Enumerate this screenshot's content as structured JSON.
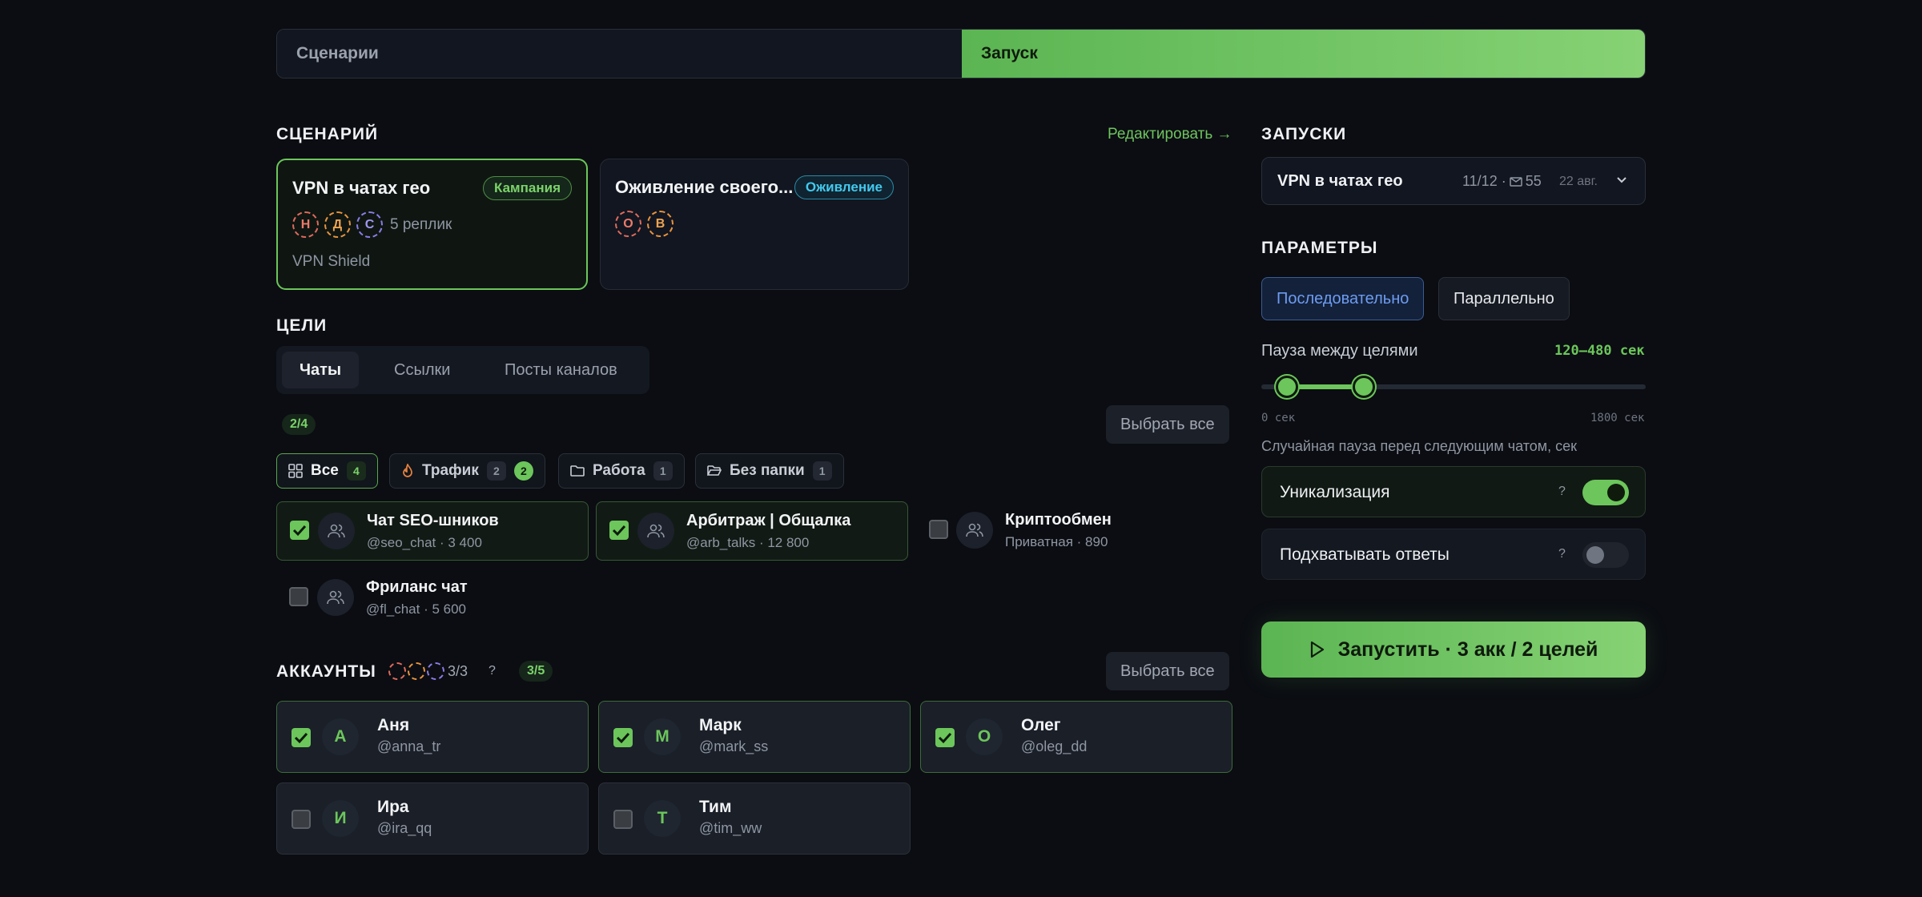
{
  "top_tabs": {
    "scenarios": "Сценарии",
    "launch": "Запуск"
  },
  "scenario_section": {
    "title": "СЦЕНАРИЙ",
    "edit_link": "Редактировать →",
    "cards": [
      {
        "title": "VPN в чатах гео",
        "badge": "Кампания",
        "avatars": [
          "Н",
          "Д",
          "С"
        ],
        "replicas": "5 реплик",
        "product": "VPN Shield"
      },
      {
        "title": "Оживление своего...",
        "badge": "Оживление",
        "avatars": [
          "О",
          "В"
        ]
      }
    ]
  },
  "targets": {
    "title": "ЦЕЛИ",
    "tabs": [
      "Чаты",
      "Ссылки",
      "Посты каналов"
    ],
    "selected_count": "2/4",
    "select_all": "Выбрать все",
    "filters": [
      {
        "label": "Все",
        "count": "4"
      },
      {
        "label": "Трафик",
        "count": "2",
        "selected": "2"
      },
      {
        "label": "Работа",
        "count": "1"
      },
      {
        "label": "Без папки",
        "count": "1"
      }
    ],
    "chats": [
      {
        "name": "Чат SEO-шников",
        "sub": "@seo_chat · 3 400",
        "checked": true
      },
      {
        "name": "Арбитраж | Общалка",
        "sub": "@arb_talks · 12 800",
        "checked": true
      },
      {
        "name": "Криптообмен",
        "sub": "Приватная · 890",
        "checked": false
      },
      {
        "name": "Фриланс чат",
        "sub": "@fl_chat · 5 600",
        "checked": false
      }
    ]
  },
  "accounts": {
    "title": "АККАУНТЫ",
    "voices": "3/3",
    "help": "?",
    "selected_count": "3/5",
    "select_all": "Выбрать все",
    "items": [
      {
        "letter": "А",
        "name": "Аня",
        "handle": "@anna_tr",
        "checked": true
      },
      {
        "letter": "М",
        "name": "Марк",
        "handle": "@mark_ss",
        "checked": true
      },
      {
        "letter": "О",
        "name": "Олег",
        "handle": "@oleg_dd",
        "checked": true
      },
      {
        "letter": "И",
        "name": "Ира",
        "handle": "@ira_qq",
        "checked": false
      },
      {
        "letter": "Т",
        "name": "Тим",
        "handle": "@tim_ww",
        "checked": false
      }
    ]
  },
  "runs": {
    "title": "ЗАПУСКИ",
    "selected": {
      "name": "VPN в чатах гео",
      "stats": "11/12 ·",
      "messages": "55",
      "date": "22 авг."
    }
  },
  "params": {
    "title": "ПАРАМЕТРЫ",
    "modes": [
      "Последовательно",
      "Параллельно"
    ],
    "active_mode": "Последовательно",
    "pause_label": "Пауза между целями",
    "pause_value": "120–480 сек",
    "range_min_label": "0 сек",
    "range_max_label": "1800 сек",
    "range_low": 120,
    "range_high": 480,
    "range_max": 1800,
    "pause_hint": "Случайная пауза перед следующим чатом, сек",
    "toggles": [
      {
        "label": "Уникализация",
        "help": "?",
        "on": true
      },
      {
        "label": "Подхватывать ответы",
        "help": "?",
        "on": false
      }
    ]
  },
  "launch_button": "Запустить · 3 акк / 2 целей",
  "colors": {
    "accent": "#6cc65b",
    "background": "#0b0d12",
    "blue": "#6d9cf2",
    "cyan": "#43c9ee"
  }
}
